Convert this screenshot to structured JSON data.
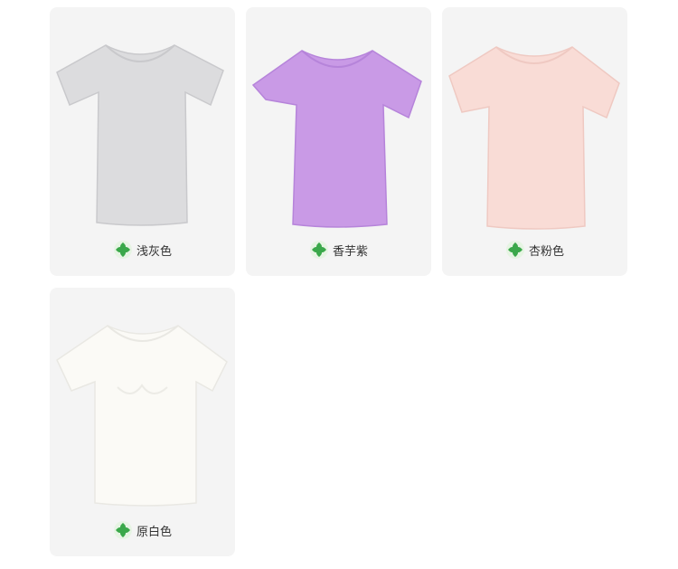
{
  "swatches": [
    {
      "label": "浅灰色",
      "shirt_color": "#dcdcde",
      "shade": "#c9c9cc"
    },
    {
      "label": "香芋紫",
      "shirt_color": "#c99ae6",
      "shade": "#b684da"
    },
    {
      "label": "杏粉色",
      "shirt_color": "#f9dcd6",
      "shade": "#efc9c2"
    },
    {
      "label": "原白色",
      "shirt_color": "#fbfaf6",
      "shade": "#e9e8e3"
    }
  ],
  "logo_icon": "green-leaf-logo-icon",
  "colors": {
    "card_bg": "#f4f4f4",
    "text": "#333333",
    "logo_green": "#3aa84a"
  }
}
